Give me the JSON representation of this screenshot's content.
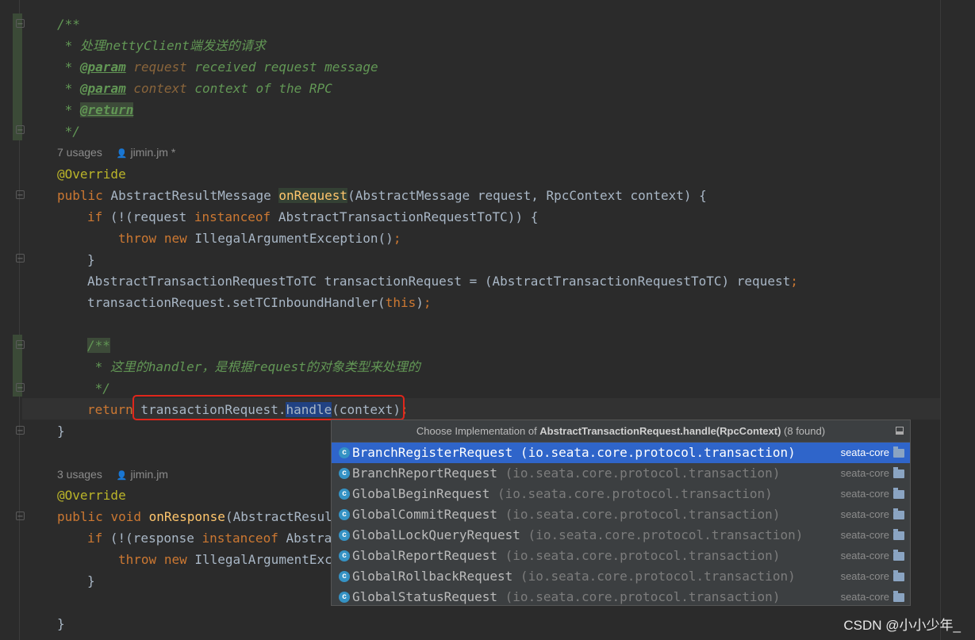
{
  "code": {
    "doc1_open": "/**",
    "doc1_l1": " * 处理nettyClient端发送的请求",
    "param_tag": "@param",
    "p1_name": "request",
    "p1_desc": " received request message",
    "p2_name": "context",
    "p2_desc": " context of the RPC",
    "return_tag": "@return",
    "doc_close": " */",
    "hint1_usages": "7 usages",
    "hint1_author": "jimin.jm *",
    "override": "@Override",
    "sig_public": "public",
    "sig_type": " AbstractResultMessage ",
    "sig_method": "onRequest",
    "sig_params": "(AbstractMessage request, RpcContext context) {",
    "if1_kw": "if",
    "if1_a": " (!(request ",
    "if1_instanceof": "instanceof",
    "if1_b": " AbstractTransactionRequestToTC)) {",
    "throw_kw": "throw",
    "new_kw": "new",
    "throw_rest": " IllegalArgumentException()",
    "semi": ";",
    "close_brace": "}",
    "assign_line": "AbstractTransactionRequestToTC transactionRequest = (AbstractTransactionRequestToTC) request",
    "set_line_a": "transactionRequest.setTCInboundHandler(",
    "this_kw": "this",
    "set_line_b": ")",
    "doc2_open": "/**",
    "doc2_l1": " * 这里的handler，是根据request的对象类型来处理的",
    "return_kw": "return",
    "ret_a": " transactionRequest.",
    "ret_handle": "handle",
    "ret_b": "(context)",
    "hint2_usages": "3 usages",
    "hint2_author": "jimin.jm",
    "void_kw": "void",
    "resp_method": "onResponse",
    "resp_params": "(AbstractResul",
    "if2_a": " (!(response ",
    "if2_b": " Abstra",
    "throw2_rest": " IllegalArgumentExc"
  },
  "popup": {
    "title_prefix": "Choose Implementation of ",
    "title_method": "AbstractTransactionRequest.handle(RpcContext)",
    "title_suffix": " (8 found)",
    "items": [
      {
        "name": "BranchRegisterRequest",
        "pkg": " (io.seata.core.protocol.transaction)",
        "module": "seata-core"
      },
      {
        "name": "BranchReportRequest",
        "pkg": " (io.seata.core.protocol.transaction)",
        "module": "seata-core"
      },
      {
        "name": "GlobalBeginRequest",
        "pkg": " (io.seata.core.protocol.transaction)",
        "module": "seata-core"
      },
      {
        "name": "GlobalCommitRequest",
        "pkg": " (io.seata.core.protocol.transaction)",
        "module": "seata-core"
      },
      {
        "name": "GlobalLockQueryRequest",
        "pkg": " (io.seata.core.protocol.transaction)",
        "module": "seata-core"
      },
      {
        "name": "GlobalReportRequest",
        "pkg": " (io.seata.core.protocol.transaction)",
        "module": "seata-core"
      },
      {
        "name": "GlobalRollbackRequest",
        "pkg": " (io.seata.core.protocol.transaction)",
        "module": "seata-core"
      },
      {
        "name": "GlobalStatusRequest",
        "pkg": " (io.seata.core.protocol.transaction)",
        "module": "seata-core"
      }
    ],
    "class_icon_letter": "c"
  },
  "watermark": "CSDN @小小少年_"
}
